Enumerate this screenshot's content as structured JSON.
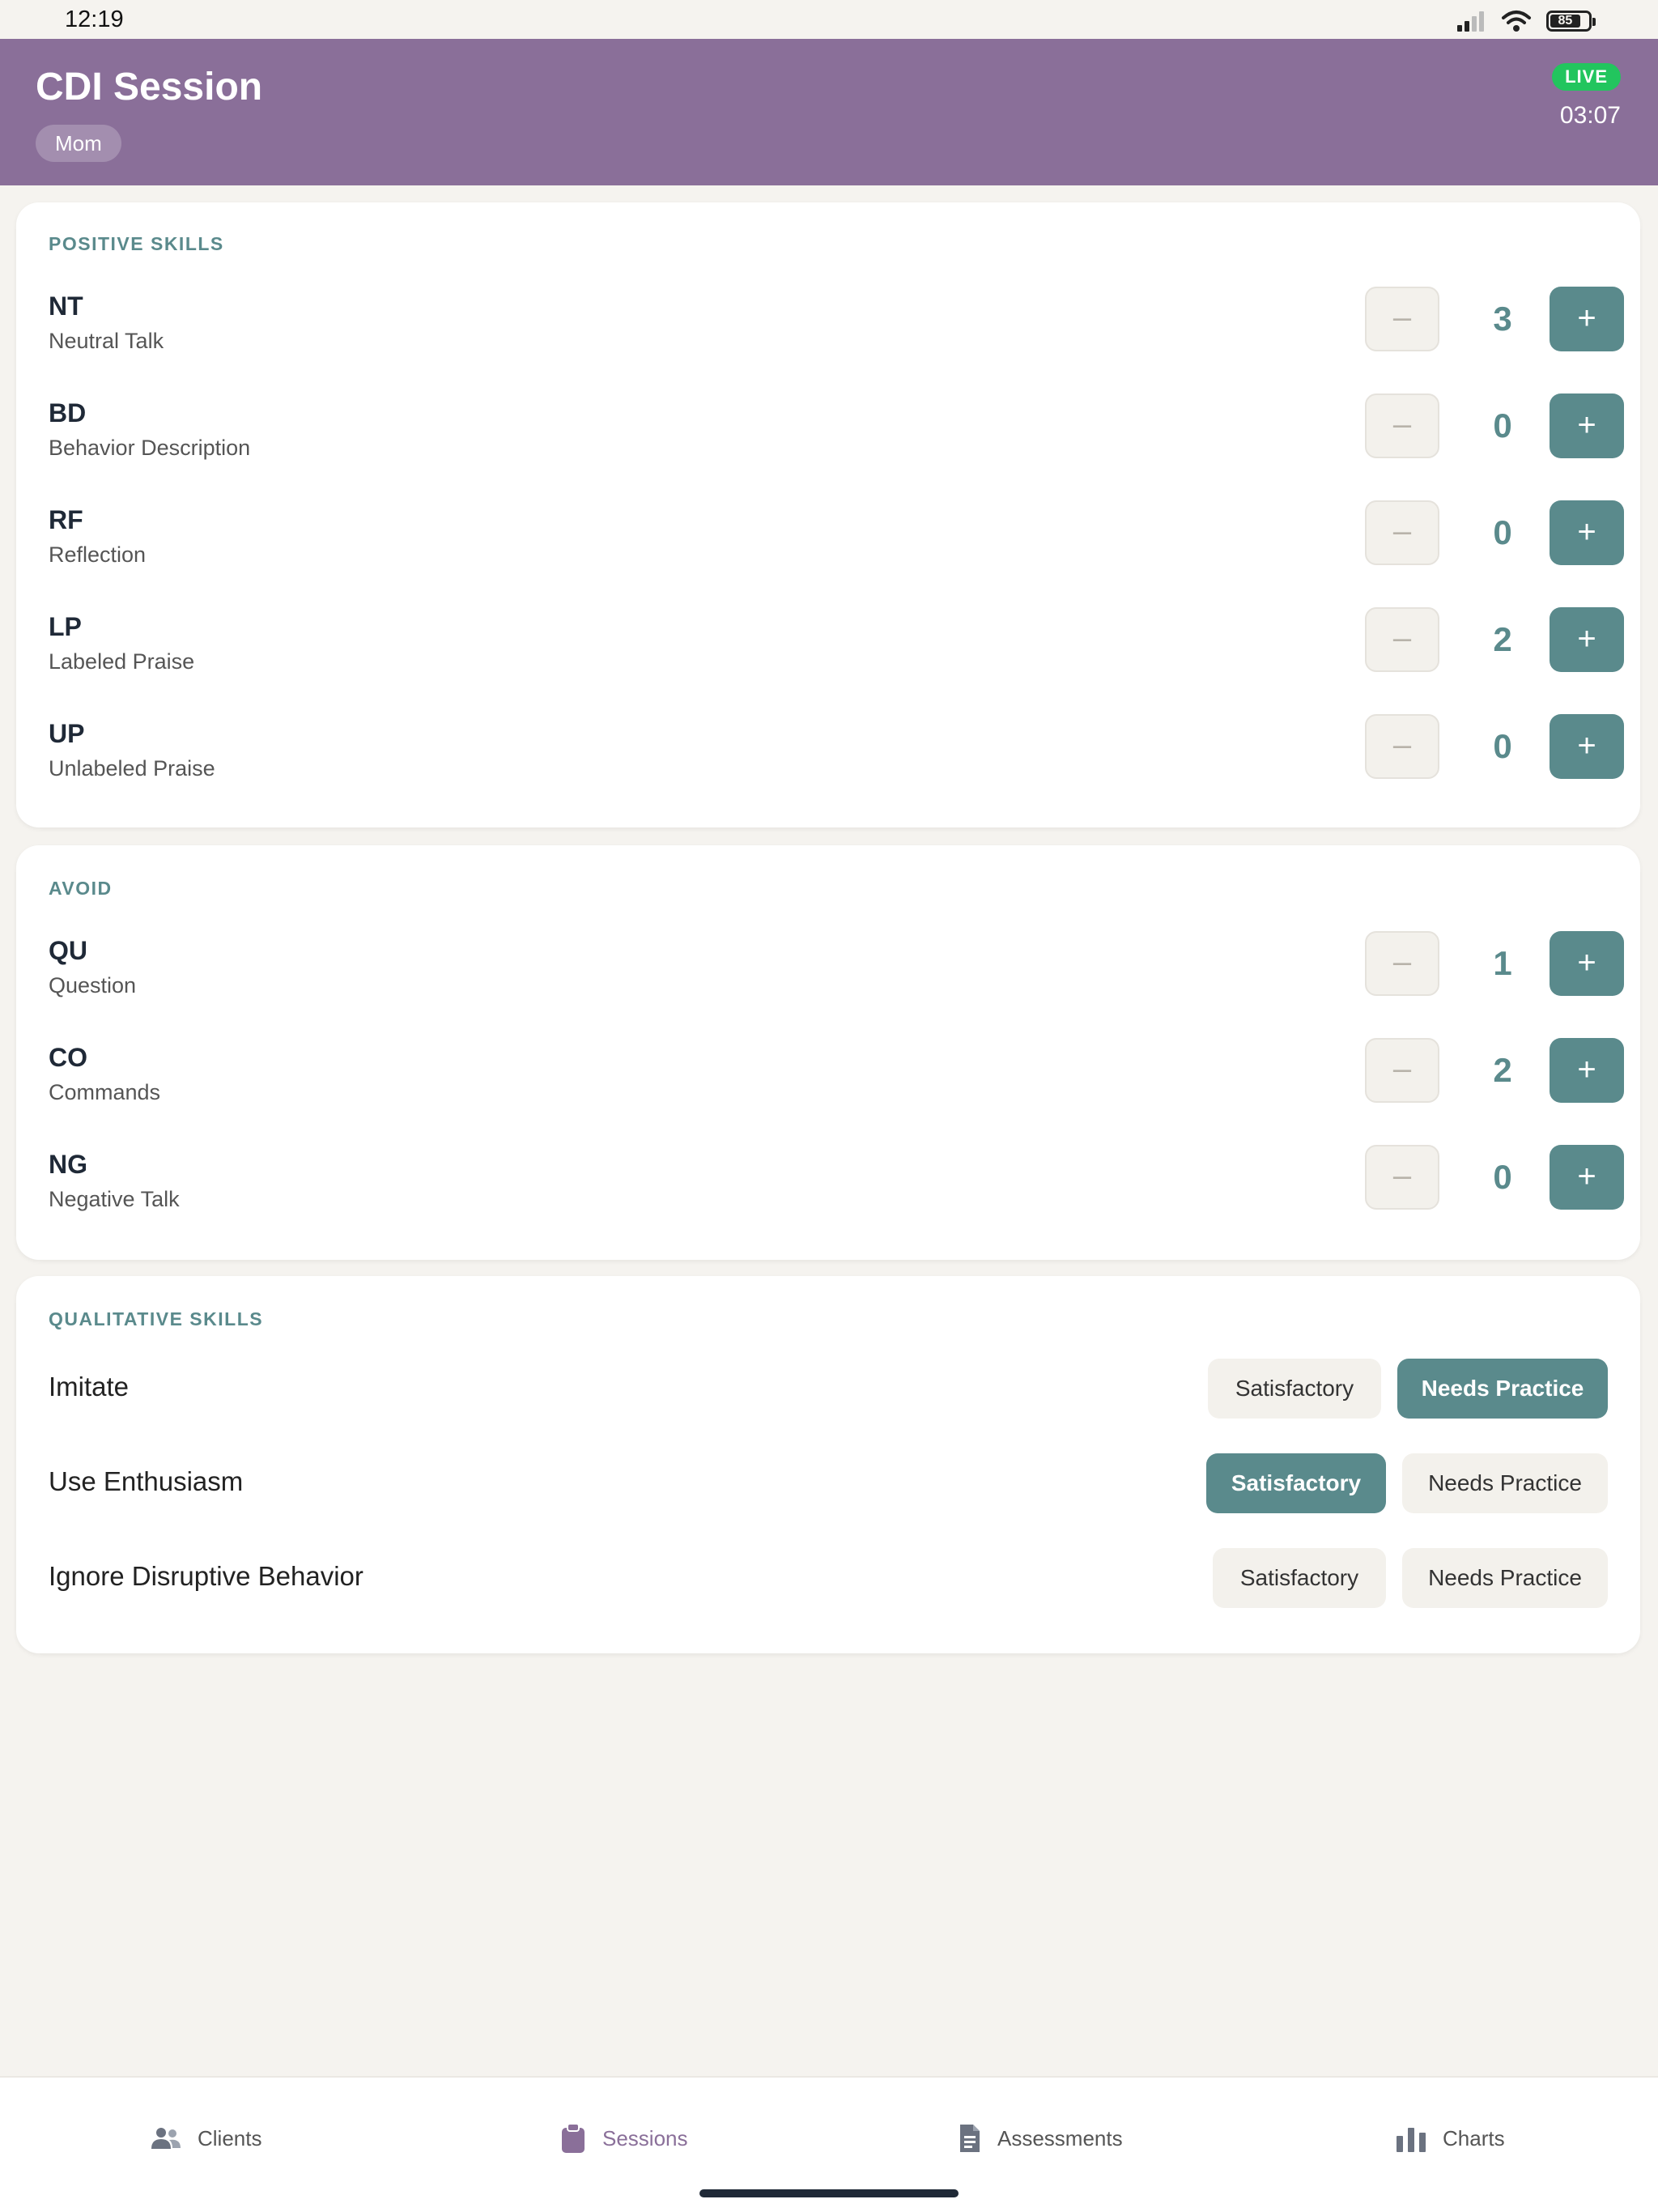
{
  "status": {
    "time": "12:19",
    "battery": "85"
  },
  "header": {
    "title": "CDI Session",
    "parent_chip": "Mom",
    "live_label": "LIVE",
    "timer": "03:07"
  },
  "positive": {
    "title": "POSITIVE SKILLS",
    "items": [
      {
        "code": "NT",
        "name": "Neutral Talk",
        "count": "3"
      },
      {
        "code": "BD",
        "name": "Behavior Description",
        "count": "0"
      },
      {
        "code": "RF",
        "name": "Reflection",
        "count": "0"
      },
      {
        "code": "LP",
        "name": "Labeled Praise",
        "count": "2"
      },
      {
        "code": "UP",
        "name": "Unlabeled Praise",
        "count": "0"
      }
    ]
  },
  "avoid": {
    "title": "AVOID",
    "items": [
      {
        "code": "QU",
        "name": "Question",
        "count": "1"
      },
      {
        "code": "CO",
        "name": "Commands",
        "count": "2"
      },
      {
        "code": "NG",
        "name": "Negative Talk",
        "count": "0"
      }
    ]
  },
  "stepper": {
    "minus": "–",
    "plus": "+"
  },
  "qualitative": {
    "title": "QUALITATIVE SKILLS",
    "satisfactory_label": "Satisfactory",
    "needs_practice_label": "Needs Practice",
    "items": [
      {
        "label": "Imitate",
        "selected": "Needs Practice"
      },
      {
        "label": "Use Enthusiasm",
        "selected": "Satisfactory"
      },
      {
        "label": "Ignore Disruptive Behavior",
        "selected": ""
      }
    ]
  },
  "tabs": [
    {
      "label": "Clients",
      "icon": "people-icon"
    },
    {
      "label": "Sessions",
      "icon": "clipboard-icon",
      "active": true
    },
    {
      "label": "Assessments",
      "icon": "document-icon"
    },
    {
      "label": "Charts",
      "icon": "bar-chart-icon"
    }
  ],
  "colors": {
    "header": "#8a6f99",
    "accent": "#5a8a8c",
    "live": "#22c55e",
    "background": "#f5f3ef"
  }
}
